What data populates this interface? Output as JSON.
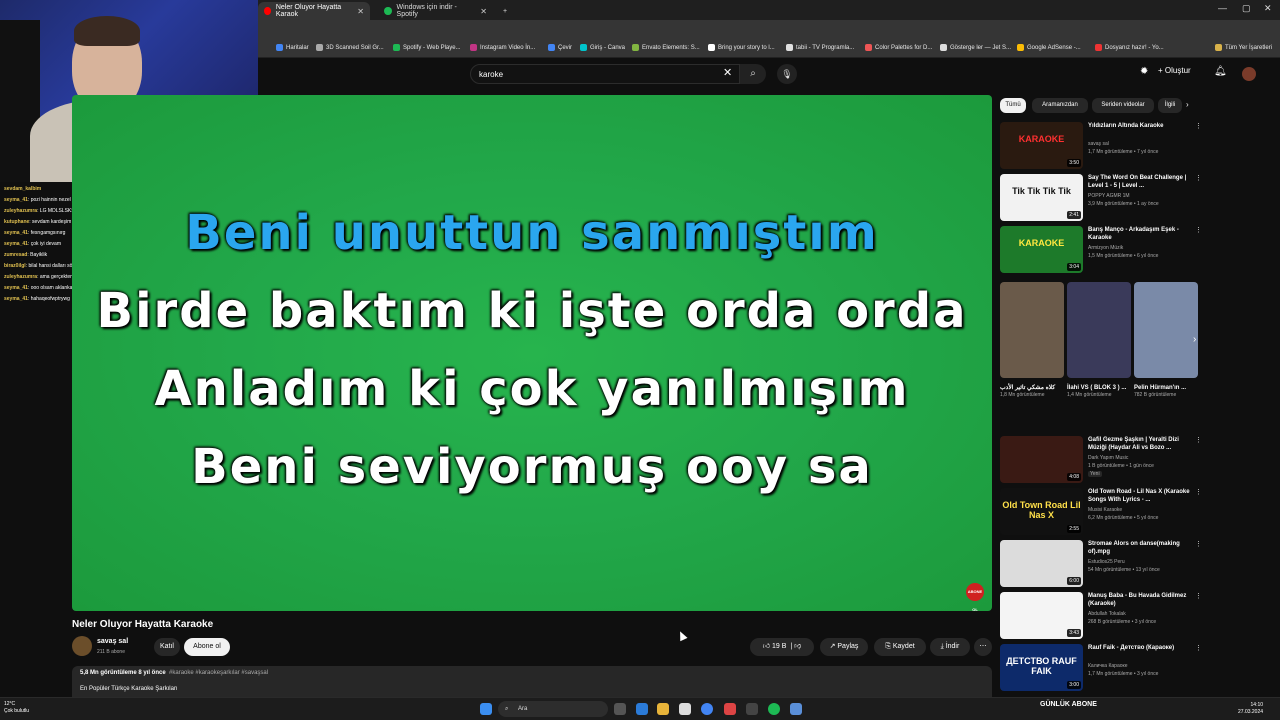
{
  "browser": {
    "tabs": [
      {
        "label": "Neler Oluyor Hayatta Karaok"
      },
      {
        "label": "Windows için indir - Spotify"
      }
    ],
    "bookmarks": [
      "Haritalar",
      "3D Scanned Soil Gr...",
      "Spotify - Web Playe...",
      "Instagram Video İn...",
      "Çevir",
      "Giriş - Canva",
      "Envato Elements: S...",
      "Bring your story to l...",
      "tabii - TV Programla...",
      "Color Palettes for D...",
      "Gösterge ler — Jet S...",
      "Google AdSense -...",
      "Dosyanız hazır! - Yo...",
      "Tüm Yer İşaretleri"
    ],
    "colors": {
      "accent": "#ff0000",
      "tab_active": "#353535"
    }
  },
  "header": {
    "search_value": "karoke",
    "create_label": "Oluştur"
  },
  "chat": [
    {
      "user": "sevdam_kalbim",
      "msg": ""
    },
    {
      "user": "seyma_41",
      "msg": ": pozi hainnin nezel ama"
    },
    {
      "user": "zuleyhazumra",
      "msg": ": LG MDLSLSKSK"
    },
    {
      "user": "kutuphane",
      "msg": ": sevdam kardeşim kulaklarımıza pass daha da atla üçaçlama"
    },
    {
      "user": "seyma_41",
      "msg": ": fesrıgamgsınırg"
    },
    {
      "user": "seyma_41",
      "msg": ": çok iyi devam"
    },
    {
      "user": "zumresad",
      "msg": ": Bayiklik"
    },
    {
      "user": "biraz0ilgl",
      "msg": ": bilal hansi dalları söyle"
    },
    {
      "user": "zuleyhazumra",
      "msg": ": ama gerçekten bayiklık unutjala"
    },
    {
      "user": "seyma_41",
      "msg": ": ooo olsam aklanka"
    },
    {
      "user": "seyma_41",
      "msg": ": hahaqeofwptrywg"
    }
  ],
  "video": {
    "lyrics": [
      {
        "text": "Beni unuttun sanmıştım",
        "highlighted": true
      },
      {
        "text": "Birde baktım ki işte orda orda",
        "highlighted": false
      },
      {
        "text": "Anladım ki çok yanılmışım",
        "highlighted": false
      },
      {
        "text": "Beni seviyormuş ooy sa",
        "highlighted": false
      }
    ],
    "title": "Neler Oluyor Hayatta Karaoke",
    "channel": "savaş sal",
    "subscribers": "211 B abone",
    "join_label": "Katıl",
    "subscribe_label": "Abone ol",
    "likes": "19 B",
    "share_label": "Paylaş",
    "save_label": "Kaydet",
    "download_label": "İndir",
    "views_time": "5,8 Mn görüntüleme  8 yıl önce",
    "tags": "#karaoke #karaokeşarkılar #savaşsal",
    "desc_more": "En Popüler Türkçe Karaoke Şarkıları",
    "logo_text": "ABONE OL"
  },
  "chips": [
    "Tümü",
    "Aramanızdan",
    "Seriden videolar",
    "İlgili"
  ],
  "recommendations": [
    {
      "title": "Yıldızların Altında Karaoke",
      "channel": "savaş sal",
      "meta": "1,7 Mn görüntüleme • 7 yıl önce",
      "duration": "3:50",
      "thumb_text": "KARAOKE",
      "thumb_color": "#2a1a10",
      "text_color": "#ff3030"
    },
    {
      "title": "Say The Word On Beat Challenge | Level 1 - 5 | Level ...",
      "channel": "POPPY AGMR 1M",
      "meta": "3,9 Mn görüntüleme • 1 ay önce",
      "duration": "2:41",
      "thumb_text": "Tik Tik Tik Tik",
      "thumb_color": "#f2f2f2",
      "text_color": "#111111"
    },
    {
      "title": "Barış Manço - Arkadaşım Eşek - Karaoke",
      "channel": "Armizyon Müzik",
      "meta": "1,5 Mn görüntüleme • 6 yıl önce",
      "duration": "3:04",
      "thumb_text": "KARAOKE",
      "thumb_color": "#1d7a2a",
      "text_color": "#ffe840"
    },
    {
      "title": "Gafil Gezme Şaşkın | Yeralti Dizi Müziği (Haydar Ali vs Bozo ...",
      "channel": "Dark Yapım Music",
      "meta": "1 B görüntüleme • 1 gün önce",
      "duration": "4:08",
      "thumb_text": "",
      "thumb_color": "#3a1a14",
      "text_color": "#ffffff",
      "badge": "Yeni"
    },
    {
      "title": "Old Town Road - Lil Nas X (Karaoke Songs With Lyrics - ...",
      "channel": "Musisi Karaoke",
      "meta": "6,2 Mn görüntüleme • 5 yıl önce",
      "duration": "2:55",
      "thumb_text": "Old Town Road Lil Nas X",
      "thumb_color": "#111111",
      "text_color": "#ffe04a"
    },
    {
      "title": "Stromae  Alors on danse(making of).mpg",
      "channel": "Estudios25 Peru",
      "meta": "54 Mn görüntüleme • 13 yıl önce",
      "duration": "6:00",
      "thumb_text": "",
      "thumb_color": "#dcdcdc",
      "text_color": "#111111"
    },
    {
      "title": "Manuş Baba - Bu Havada Gidilmez (Karaoke)",
      "channel": "Abdullah Tokalak",
      "meta": "268 B görüntüleme • 3 yıl önce",
      "duration": "3:43",
      "thumb_text": "",
      "thumb_color": "#f4f4f4",
      "text_color": "#111111"
    },
    {
      "title": "Rauf Faik - Детство (Караоке)",
      "channel": "Каличка Караоке",
      "meta": "1,7 Mn görüntüleme • 3 yıl önce",
      "duration": "3:00",
      "thumb_text": "ДЕТСТВО RAUF FAIK",
      "thumb_color": "#0d2a6a",
      "text_color": "#ffffff"
    }
  ],
  "shorts": [
    {
      "title": "كلاه مشكي تاثير الأدب",
      "views": "1,8 Mn görüntüleme",
      "color": "#6a5a4a"
    },
    {
      "title": "İlahi VS ( BLOK 3 ) ...",
      "views": "1,4 Mn görüntüleme",
      "color": "#3a3a5a"
    },
    {
      "title": "Pelin Hürman'ın ...",
      "views": "782 B görüntüleme",
      "color": "#7a8aa8"
    }
  ],
  "taskbar": {
    "weather_temp": "12°C",
    "weather_desc": "Çok bulutlu",
    "search_label": "Ara",
    "tray_text": "GÜNLÜK ABONE",
    "time": "14:10",
    "date": "27.03.2024"
  }
}
